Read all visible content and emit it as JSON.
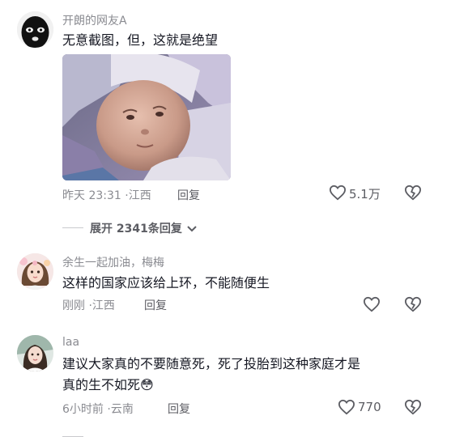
{
  "comments": [
    {
      "username": "开朗的网友A",
      "text": "无意截图，但，这就是绝望",
      "time": "昨天 23:31",
      "location": "江西",
      "reply_label": "回复",
      "like_count": "5.1万",
      "like_icon": "heart-outline-icon",
      "dislike_icon": "broken-heart-icon"
    },
    {
      "username": "余生一起加油，梅梅",
      "text": "这样的国家应该给上环，不能随便生",
      "time": "刚刚",
      "location": "江西",
      "reply_label": "回复",
      "like_count": "",
      "like_icon": "heart-outline-icon",
      "dislike_icon": "broken-heart-icon"
    },
    {
      "username": "laa",
      "text_line1": "建议大家真的不要随意死，死了投胎到这种家庭才是",
      "text_line2": "真的生不如死",
      "emoji": "😳",
      "time": "6小时前",
      "location": "云南",
      "reply_label": "回复",
      "like_count": "770",
      "like_icon": "heart-outline-icon",
      "dislike_icon": "broken-heart-icon"
    }
  ],
  "expand_replies": {
    "label": "展开 2341条回复",
    "icon": "chevron-down-icon"
  },
  "colors": {
    "text": "#161823",
    "meta": "#8a8b91",
    "reply": "#5c5d63"
  }
}
